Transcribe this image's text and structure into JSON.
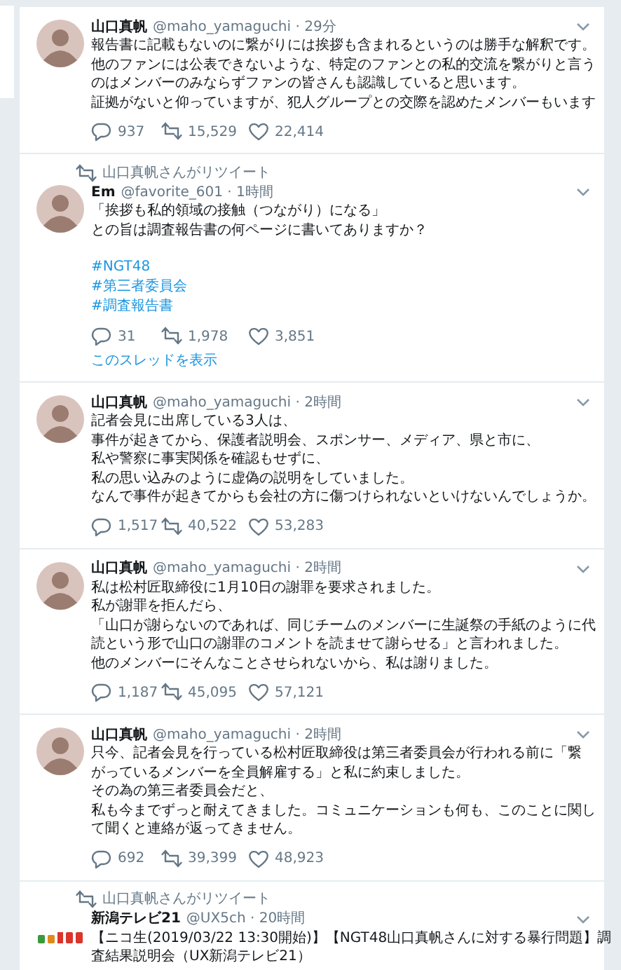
{
  "timeline": [
    {
      "kind": "person",
      "name": "山口真帆",
      "meta": "@maho_yamaguchi · 29分",
      "lines": [
        "報告書に記載もないのに繋がりには挨拶も含まれるというのは勝手な解釈です。",
        "他のファンには公表できないような、特定のファンとの私的交流を繋がりと言う",
        "のはメンバーのみならずファンの皆さんも認識していると思います。",
        "証拠がないと仰っていますが、犯人グループとの交際を認めたメンバーもいます"
      ],
      "stats": {
        "replies": "937",
        "retweets": "15,529",
        "likes": "22,414"
      }
    },
    {
      "retweet_note": "山口真帆さんがリツイート",
      "kind": "person",
      "name": "Em",
      "meta": "@favorite_601 · 1時間",
      "lines": [
        "「挨拶も私的領域の接触（つながり）になる」",
        "との旨は調査報告書の何ページに書いてありますか？"
      ],
      "hashtags": [
        "#NGT48",
        "#第三者委員会",
        "#調査報告書"
      ],
      "stats": {
        "replies": "31",
        "retweets": "1,978",
        "likes": "3,851"
      },
      "thread_link": "このスレッドを表示"
    },
    {
      "kind": "person",
      "name": "山口真帆",
      "meta": "@maho_yamaguchi · 2時間",
      "lines": [
        "記者会見に出席している3人は、",
        "事件が起きてから、保護者説明会、スポンサー、メディア、県と市に、",
        "私や警察に事実関係を確認もせずに、",
        "私の思い込みのように虚偽の説明をしていました。",
        "なんで事件が起きてからも会社の方に傷つけられないといけないんでしょうか。"
      ],
      "stats": {
        "replies": "1,517",
        "retweets": "40,522",
        "likes": "53,283"
      }
    },
    {
      "kind": "person",
      "name": "山口真帆",
      "meta": "@maho_yamaguchi · 2時間",
      "lines": [
        "私は松村匠取締役に1月10日の謝罪を要求されました。",
        "私が謝罪を拒んだら、",
        "「山口が謝らないのであれば、同じチームのメンバーに生誕祭の手紙のように代",
        "読という形で山口の謝罪のコメントを読ませて謝らせる」と言われました。",
        "他のメンバーにそんなことさせられないから、私は謝りました。"
      ],
      "stats": {
        "replies": "1,187",
        "retweets": "45,095",
        "likes": "57,121"
      }
    },
    {
      "kind": "person",
      "name": "山口真帆",
      "meta": "@maho_yamaguchi · 2時間",
      "lines": [
        "只今、記者会見を行っている松村匠取締役は第三者委員会が行われる前に「繋",
        "がっているメンバーを全員解雇する」と私に約束しました。",
        "その為の第三者委員会だと、",
        "私も今までずっと耐えてきました。コミュニケーションも何も、このことに関し",
        "て聞くと連絡が返ってきません。"
      ],
      "stats": {
        "replies": "692",
        "retweets": "39,399",
        "likes": "48,923"
      }
    },
    {
      "retweet_note": "山口真帆さんがリツイート",
      "kind": "logo",
      "name": "新潟テレビ21",
      "meta": "@UX5ch · 20時間",
      "lines": [
        "【ニコ生(2019/03/22 13:30開始)】【NGT48山口真帆さんに対する暴行問題】調",
        "査結果説明会（UX新潟テレビ21）"
      ]
    }
  ]
}
